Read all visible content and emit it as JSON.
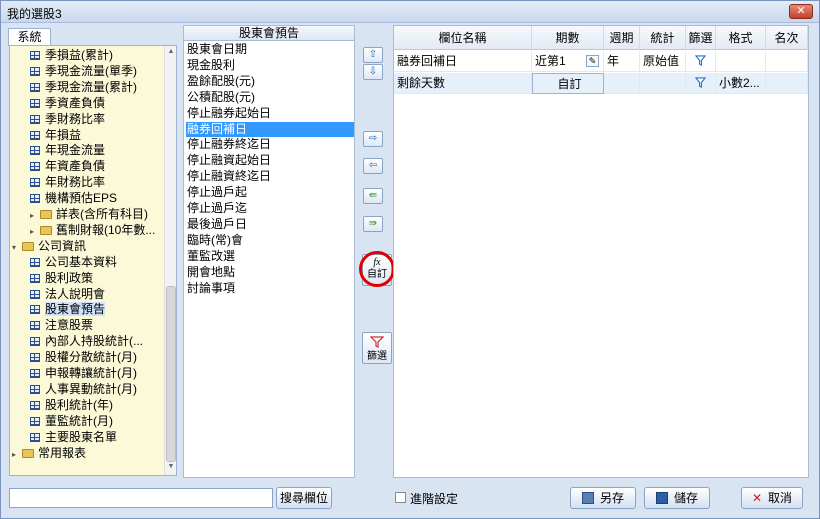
{
  "window": {
    "title": "我的選股3",
    "close_glyph": "✕"
  },
  "left_panel": {
    "tab_label": "系統",
    "tree": [
      {
        "label": "季損益(累計)",
        "type": "table",
        "level": 2
      },
      {
        "label": "季現金流量(單季)",
        "type": "table",
        "level": 2
      },
      {
        "label": "季現金流量(累計)",
        "type": "table",
        "level": 2
      },
      {
        "label": "季資產負債",
        "type": "table",
        "level": 2
      },
      {
        "label": "季財務比率",
        "type": "table",
        "level": 2
      },
      {
        "label": "年損益",
        "type": "table",
        "level": 2
      },
      {
        "label": "年現金流量",
        "type": "table",
        "level": 2
      },
      {
        "label": "年資產負債",
        "type": "table",
        "level": 2
      },
      {
        "label": "年財務比率",
        "type": "table",
        "level": 2
      },
      {
        "label": "機構預估EPS",
        "type": "table",
        "level": 2
      },
      {
        "label": "詳表(含所有科目)",
        "type": "folder-collapsed",
        "level": 2
      },
      {
        "label": "舊制財報(10年數...",
        "type": "folder-collapsed",
        "level": 2
      },
      {
        "label": "公司資訊",
        "type": "folder-expanded",
        "level": 1
      },
      {
        "label": "公司基本資料",
        "type": "table",
        "level": 2
      },
      {
        "label": "股利政策",
        "type": "table",
        "level": 2
      },
      {
        "label": "法人說明會",
        "type": "table",
        "level": 2
      },
      {
        "label": "股東會預告",
        "type": "table",
        "level": 2,
        "selected": true
      },
      {
        "label": "注意股票",
        "type": "table",
        "level": 2
      },
      {
        "label": "內部人持股統計(...",
        "type": "table",
        "level": 2
      },
      {
        "label": "股權分散統計(月)",
        "type": "table",
        "level": 2
      },
      {
        "label": "申報轉讓統計(月)",
        "type": "table",
        "level": 2
      },
      {
        "label": "人事異動統計(月)",
        "type": "table",
        "level": 2
      },
      {
        "label": "股利統計(年)",
        "type": "table",
        "level": 2
      },
      {
        "label": "董監統計(月)",
        "type": "table",
        "level": 2
      },
      {
        "label": "主要股東名單",
        "type": "table",
        "level": 2
      },
      {
        "label": "常用報表",
        "type": "folder-collapsed",
        "level": 1
      }
    ]
  },
  "field_list": {
    "header": "股東會預告",
    "items": [
      "股東會日期",
      "現金股利",
      "盈餘配股(元)",
      "公積配股(元)",
      "停止融券起始日",
      "融券回補日",
      "停止融券終迄日",
      "停止融資起始日",
      "停止融資終迄日",
      "停止過戶起",
      "停止過戶迄",
      "最後過戶日",
      "臨時(常)會",
      "董監改選",
      "開會地點",
      "討論事項"
    ],
    "selected_index": 5
  },
  "move_buttons": {
    "up": "⇧",
    "down": "⇩",
    "add": "⇨",
    "remove": "⇦",
    "add_all": "⇛",
    "remove_all": "⇚",
    "custom_icon": "fx",
    "custom_label": "自訂",
    "filter_label": "篩選"
  },
  "grid": {
    "columns": [
      "欄位名稱",
      "期數",
      "週期",
      "統計",
      "篩選",
      "格式",
      "名次"
    ],
    "rows": [
      {
        "name": "融券回補日",
        "period": "近第1",
        "cycle": "年",
        "stat": "原始值",
        "format": "",
        "rank": ""
      },
      {
        "name": "剩餘天數",
        "period": "自訂",
        "cycle": "",
        "stat": "",
        "format": "小數2...",
        "rank": ""
      }
    ]
  },
  "bottom": {
    "search_placeholder": "",
    "search_button": "搜尋欄位",
    "advanced_label": "進階設定",
    "save_as": "另存",
    "save": "儲存",
    "cancel": "取消"
  },
  "colors": {
    "accent": "#3399ff",
    "tree_bg": "#fbf9d8",
    "window_bg": "#d9e4f2",
    "highlight": "#e00000"
  }
}
